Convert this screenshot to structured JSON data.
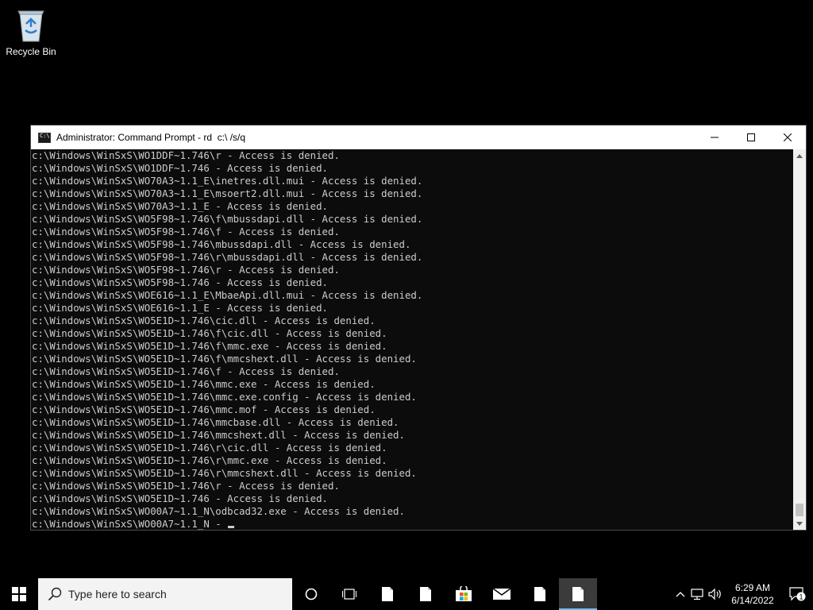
{
  "desktop": {
    "recycle_bin_label": "Recycle Bin"
  },
  "window": {
    "title": "Administrator: Command Prompt - rd  c:\\ /s/q",
    "lines": [
      "c:\\Windows\\WinSxS\\WO1DDF~1.746\\r - Access is denied.",
      "c:\\Windows\\WinSxS\\WO1DDF~1.746 - Access is denied.",
      "c:\\Windows\\WinSxS\\WO70A3~1.1_E\\inetres.dll.mui - Access is denied.",
      "c:\\Windows\\WinSxS\\WO70A3~1.1_E\\msoert2.dll.mui - Access is denied.",
      "c:\\Windows\\WinSxS\\WO70A3~1.1_E - Access is denied.",
      "c:\\Windows\\WinSxS\\WO5F98~1.746\\f\\mbussdapi.dll - Access is denied.",
      "c:\\Windows\\WinSxS\\WO5F98~1.746\\f - Access is denied.",
      "c:\\Windows\\WinSxS\\WO5F98~1.746\\mbussdapi.dll - Access is denied.",
      "c:\\Windows\\WinSxS\\WO5F98~1.746\\r\\mbussdapi.dll - Access is denied.",
      "c:\\Windows\\WinSxS\\WO5F98~1.746\\r - Access is denied.",
      "c:\\Windows\\WinSxS\\WO5F98~1.746 - Access is denied.",
      "c:\\Windows\\WinSxS\\WOE616~1.1_E\\MbaeApi.dll.mui - Access is denied.",
      "c:\\Windows\\WinSxS\\WOE616~1.1_E - Access is denied.",
      "c:\\Windows\\WinSxS\\WO5E1D~1.746\\cic.dll - Access is denied.",
      "c:\\Windows\\WinSxS\\WO5E1D~1.746\\f\\cic.dll - Access is denied.",
      "c:\\Windows\\WinSxS\\WO5E1D~1.746\\f\\mmc.exe - Access is denied.",
      "c:\\Windows\\WinSxS\\WO5E1D~1.746\\f\\mmcshext.dll - Access is denied.",
      "c:\\Windows\\WinSxS\\WO5E1D~1.746\\f - Access is denied.",
      "c:\\Windows\\WinSxS\\WO5E1D~1.746\\mmc.exe - Access is denied.",
      "c:\\Windows\\WinSxS\\WO5E1D~1.746\\mmc.exe.config - Access is denied.",
      "c:\\Windows\\WinSxS\\WO5E1D~1.746\\mmc.mof - Access is denied.",
      "c:\\Windows\\WinSxS\\WO5E1D~1.746\\mmcbase.dll - Access is denied.",
      "c:\\Windows\\WinSxS\\WO5E1D~1.746\\mmcshext.dll - Access is denied.",
      "c:\\Windows\\WinSxS\\WO5E1D~1.746\\r\\cic.dll - Access is denied.",
      "c:\\Windows\\WinSxS\\WO5E1D~1.746\\r\\mmc.exe - Access is denied.",
      "c:\\Windows\\WinSxS\\WO5E1D~1.746\\r\\mmcshext.dll - Access is denied.",
      "c:\\Windows\\WinSxS\\WO5E1D~1.746\\r - Access is denied.",
      "c:\\Windows\\WinSxS\\WO5E1D~1.746 - Access is denied.",
      "c:\\Windows\\WinSxS\\WO00A7~1.1_N\\odbcad32.exe - Access is denied."
    ],
    "prompt_line": "c:\\Windows\\WinSxS\\WO00A7~1.1_N - "
  },
  "taskbar": {
    "search_placeholder": "Type here to search",
    "clock_time": "6:29 AM",
    "clock_date": "6/14/2022",
    "notification_count": "1"
  },
  "colors": {
    "console_bg": "#0c0c0c",
    "console_text": "#cccccc",
    "taskbar_bg": "#000000",
    "active_indicator": "#76b9ed"
  },
  "icons": {
    "start": "windows-logo-icon",
    "search": "search-icon",
    "cortana": "cortana-circle-icon",
    "task_view": "task-view-icon",
    "store": "microsoft-store-icon",
    "mail": "mail-icon",
    "document": "document-icon",
    "tray_up": "chevron-up-icon",
    "network": "network-icon",
    "volume": "volume-icon",
    "notification": "notification-icon"
  }
}
